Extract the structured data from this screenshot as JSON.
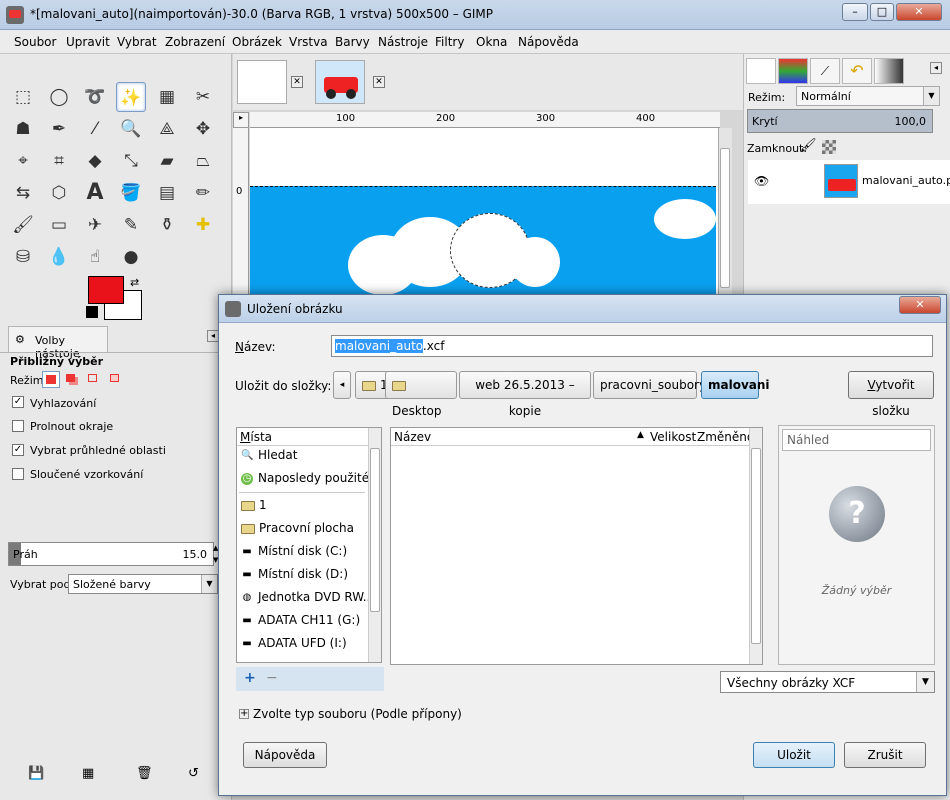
{
  "window": {
    "title": "*[malovani_auto](naimportován)-30.0 (Barva RGB, 1 vrstva) 500x500 – GIMP"
  },
  "menu": [
    "Soubor",
    "Upravit",
    "Vybrat",
    "Zobrazení",
    "Obrázek",
    "Vrstva",
    "Barvy",
    "Nástroje",
    "Filtry",
    "Okna",
    "Nápověda"
  ],
  "toolbox": {
    "tab_label": "Volby nástroje",
    "tool_title": "Přibližný výběr",
    "mode_label": "Režim:",
    "antialias": "Vyhlazování",
    "feather": "Prolnout okraje",
    "transparent": "Vybrat průhledné oblasti",
    "merged": "Sloučené vzorkování",
    "threshold_label": "Práh",
    "threshold_value": "15.0",
    "threshold_fraction": 0.06,
    "select_by_label": "Vybrat podle:",
    "select_by_value": "Složené barvy"
  },
  "rulers": {
    "h": [
      "100",
      "200",
      "300",
      "400"
    ],
    "v_zero": "0"
  },
  "layers": {
    "mode_label": "Režim:",
    "mode_value": "Normální",
    "opacity_label": "Krytí",
    "opacity_value": "100,0",
    "lock_label": "Zamknout:",
    "layer_name": "malovani_auto.pn"
  },
  "dialog": {
    "title": "Uložení obrázku",
    "name_label": "Název:",
    "name_selected": "malovani_auto",
    "name_ext": ".xcf",
    "save_in_label": "Uložit do složky:",
    "crumbs": [
      "1",
      "Desktop",
      "web 26.5.2013 – kopie",
      "pracovni_soubory",
      "malovani"
    ],
    "create_folder": "Vytvořit složku",
    "places_header": "Místa",
    "places": [
      "Hledat",
      "Naposledy použité",
      "1",
      "Pracovní plocha",
      "Místní disk (C:)",
      "Místní disk (D:)",
      "Jednotka DVD RW...",
      "ADATA CH11 (G:)",
      "ADATA UFD (I:)"
    ],
    "files_header_name": "Název",
    "files_header_size": "Velikost",
    "files_header_changed": "Změněno",
    "preview_label": "Náhled",
    "preview_empty": "Žádný výběr",
    "filter_value": "Všechny obrázky XCF",
    "file_type_label": "Zvolte typ souboru (Podle přípony)",
    "help_button": "Nápověda",
    "save_button": "Uložit",
    "cancel_button": "Zrušit"
  },
  "colors": {
    "foreground": "#e9121a",
    "background": "#ffffff",
    "sky": "#0aa0f0"
  }
}
